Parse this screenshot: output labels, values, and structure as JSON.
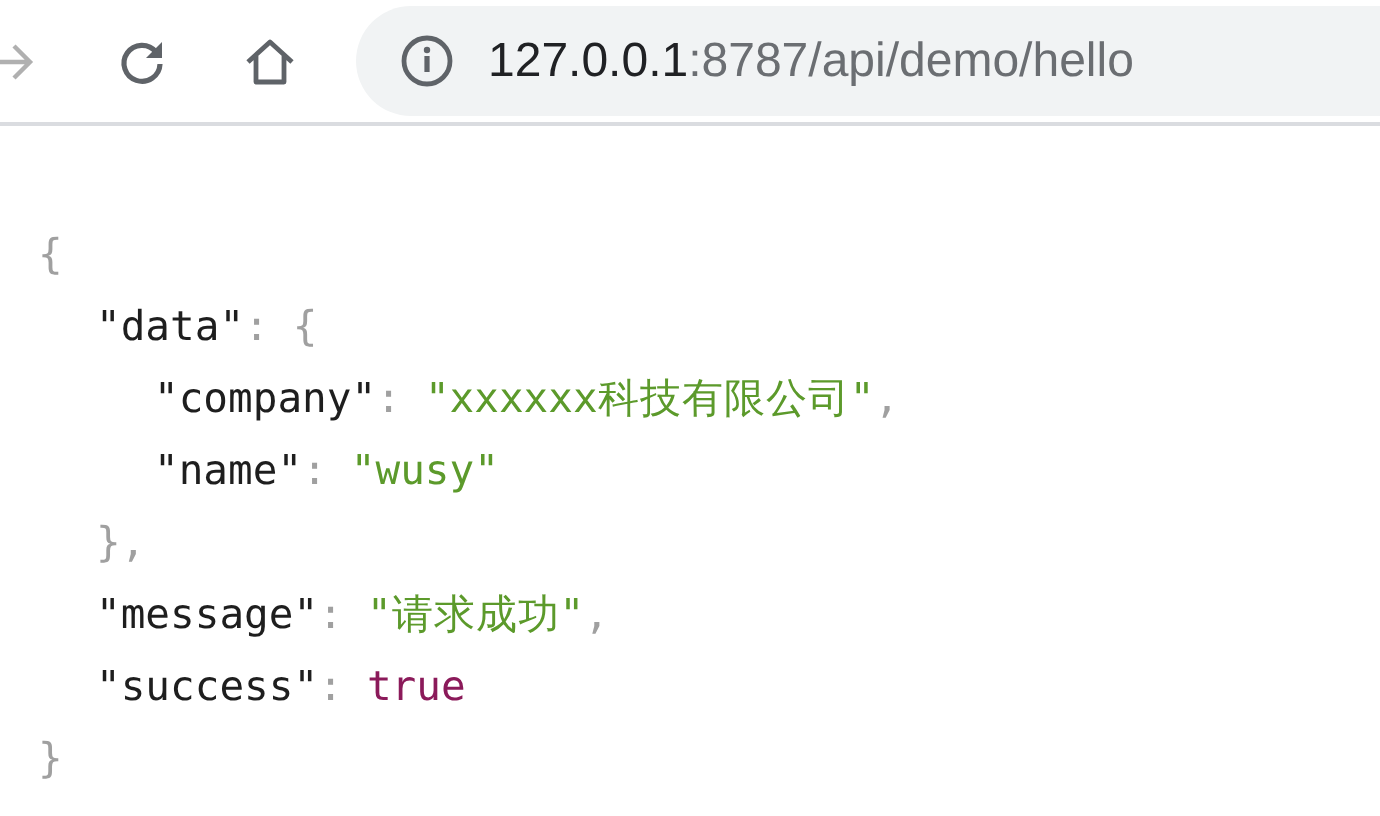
{
  "toolbar": {
    "url_host": "127.0.0.1",
    "url_rest": ":8787/api/demo/hello"
  },
  "json_view": {
    "open": "{",
    "close": "}",
    "children": [
      {
        "key": "\"data\"",
        "sep": ":",
        "open": "{",
        "close": "}",
        "comma": ",",
        "children": [
          {
            "key": "\"company\"",
            "sep": ":",
            "value": "\"xxxxxx科技有限公司\"",
            "kind": "string",
            "comma": ","
          },
          {
            "key": "\"name\"",
            "sep": ":",
            "value": "\"wusy\"",
            "kind": "string"
          }
        ]
      },
      {
        "key": "\"message\"",
        "sep": ":",
        "value": "\"请求成功\"",
        "kind": "string",
        "comma": ","
      },
      {
        "key": "\"success\"",
        "sep": ":",
        "value": "true",
        "kind": "boolean"
      }
    ]
  }
}
